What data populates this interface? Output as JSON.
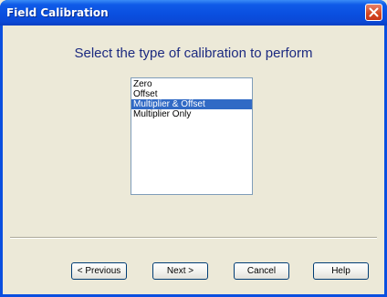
{
  "window": {
    "title": "Field Calibration"
  },
  "heading": "Select the type of calibration to perform",
  "calibration_types": {
    "items": [
      "Zero",
      "Offset",
      "Multiplier & Offset",
      "Multiplier Only"
    ],
    "selected": "Multiplier & Offset"
  },
  "buttons": {
    "previous": "< Previous",
    "next": "Next >",
    "cancel": "Cancel",
    "help": "Help"
  },
  "colors": {
    "title_bar": "#0a4fe0",
    "selection": "#316ac5",
    "heading": "#1c2a80",
    "close": "#d4461f"
  },
  "icons": {
    "close": "close-icon"
  }
}
